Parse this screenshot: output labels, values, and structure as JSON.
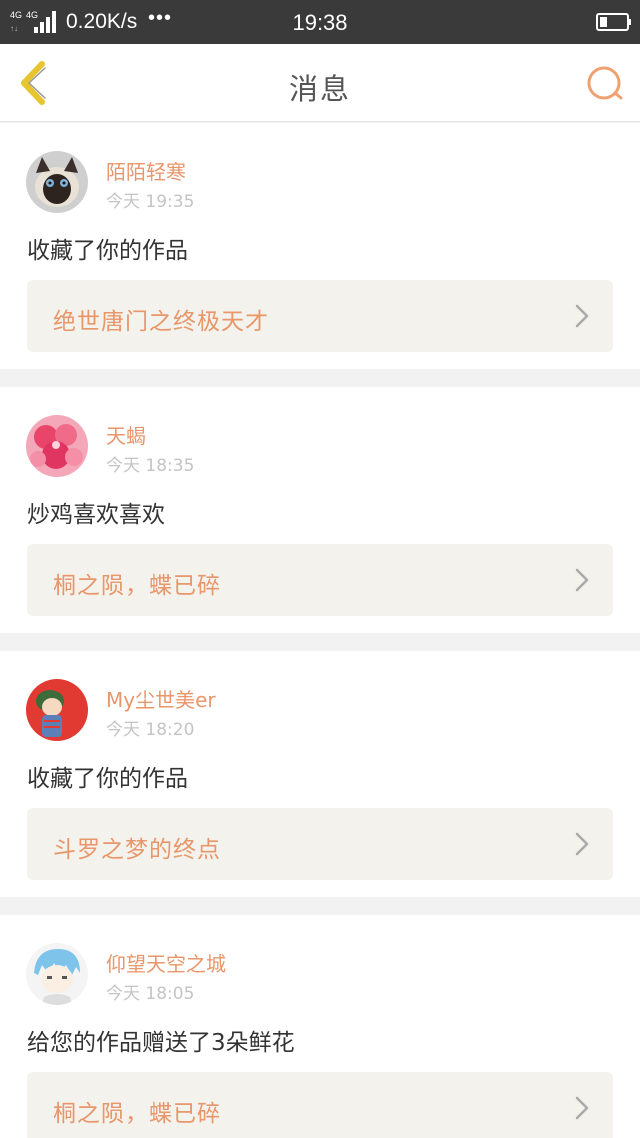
{
  "status_bar": {
    "net_speed": "0.20K/s",
    "dots": "•••",
    "time": "19:38",
    "network_label": "4G",
    "icons": [
      "signal-icon",
      "battery-icon"
    ]
  },
  "nav": {
    "title": "消息",
    "back_icon": "chevron-left-icon",
    "search_icon": "search-icon"
  },
  "colors": {
    "accent": "#e8966a",
    "back_arrow": "#e6c531",
    "status_bar_bg": "#3a3a3a",
    "link_card_bg": "#f3f2ec",
    "page_bg": "#f2f2f2"
  },
  "messages": [
    {
      "username": "陌陌轻寒",
      "time": "今天 19:35",
      "text": "收藏了你的作品",
      "work": "绝世唐门之终极天才",
      "avatar": "cat-avatar"
    },
    {
      "username": "天蝎",
      "time": "今天 18:35",
      "text": "炒鸡喜欢喜欢",
      "work": "桐之陨，蝶已碎",
      "avatar": "flower-avatar"
    },
    {
      "username": "My尘世美er",
      "time": "今天 18:20",
      "text": "收藏了你的作品",
      "work": "斗罗之梦的终点",
      "avatar": "cartoon-boy-avatar"
    },
    {
      "username": "仰望天空之城",
      "time": "今天 18:05",
      "text": "给您的作品赠送了3朵鲜花",
      "work": "桐之陨，蝶已碎",
      "avatar": "anime-boy-avatar"
    }
  ]
}
